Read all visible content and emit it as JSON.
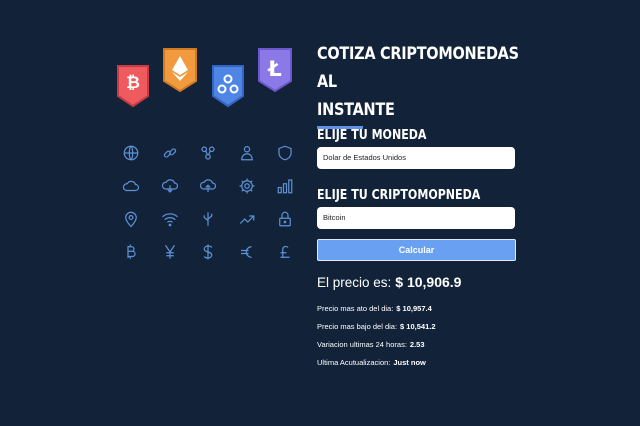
{
  "colors": {
    "background": "#122339",
    "accent": "#69a0f2",
    "icon_line": "#5d92d6",
    "bitcoin_tag": "#ef5a5e",
    "ethereum_tag": "#f19a3e",
    "ripple_tag": "#4f86e6",
    "litecoin_tag": "#8a79e6"
  },
  "hero": {
    "tags": [
      "bitcoin-icon",
      "ethereum-icon",
      "ripple-icon",
      "litecoin-icon"
    ],
    "icons": [
      "globe-icon",
      "link-icon",
      "network-icon",
      "user-icon",
      "shield-icon",
      "cloud-icon",
      "cloud-download-icon",
      "cloud-upload-icon",
      "gear-icon",
      "bar-chart-icon",
      "location-pin-icon",
      "wifi-icon",
      "usb-icon",
      "trend-up-icon",
      "lock-icon",
      "bitcoin-icon",
      "yen-icon",
      "dollar-icon",
      "euro-icon",
      "pound-icon"
    ]
  },
  "panel": {
    "title_line1": "COTIZA CRIPTOMONEDAS AL",
    "title_line2": "INSTANTE",
    "currency_label": "ELIJE TU MONEDA",
    "currency_value": "Dolar de Estados Unidos",
    "crypto_label": "ELIJE TU CRIPTOMOPNEDA",
    "crypto_value": "Bitcoin",
    "button_label": "Calcular"
  },
  "result": {
    "price_label": "El precio es:",
    "price_value": "$ 10,906.9",
    "high_label": "Precio mas ato del dia:",
    "high_value": "$ 10,957.4",
    "low_label": "Precio mas bajo del dia:",
    "low_value": "$ 10,541.2",
    "change_label": "Variacion ultimas 24 horas:",
    "change_value": "2.53",
    "updated_label": "Ultima Acutualizacion:",
    "updated_value": "Just now"
  }
}
